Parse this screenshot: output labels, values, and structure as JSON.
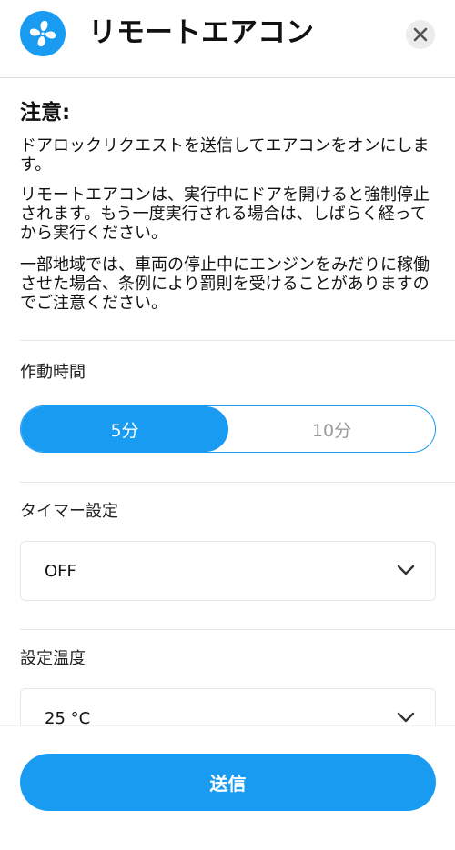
{
  "header": {
    "title": "リモートエアコン",
    "app_icon": "fan-icon",
    "close_icon": "close-icon"
  },
  "notice": {
    "title": "注意:",
    "paragraphs": [
      "ドアロックリクエストを送信してエアコンをオンにします。",
      "リモートエアコンは、実行中にドアを開けると強制停止されます。もう一度実行される場合は、しばらく経ってから実行ください。",
      "一部地域では、車両の停止中にエンジンをみだりに稼働させた場合、条例により罰則を受けることがありますのでご注意ください。"
    ]
  },
  "run_time": {
    "label": "作動時間",
    "options": [
      "5分",
      "10分"
    ],
    "selected": "5分"
  },
  "timer": {
    "label": "タイマー設定",
    "value": "OFF",
    "icon": "chevron-down-icon"
  },
  "temperature": {
    "label": "設定温度",
    "value": "25 °C",
    "icon": "chevron-down-icon"
  },
  "send_button": {
    "label": "送信"
  },
  "colors": {
    "accent": "#1a9bf2",
    "text": "#111111",
    "muted": "#9a9a9a",
    "divider": "#e6e6e6"
  }
}
